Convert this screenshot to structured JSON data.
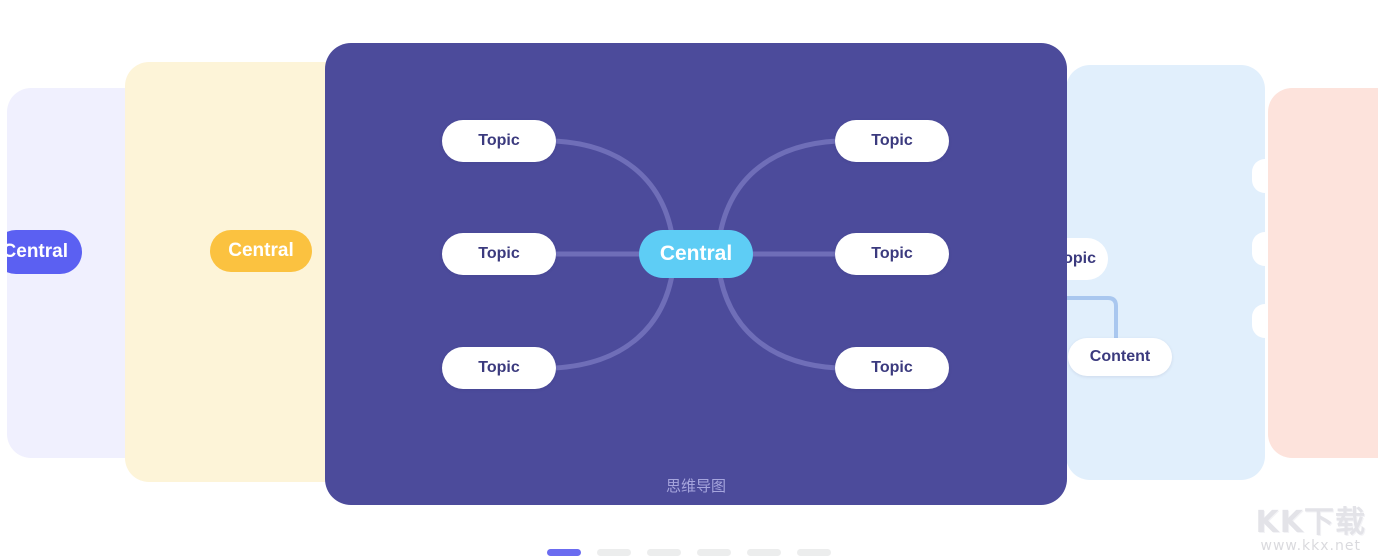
{
  "meta": {
    "scene": "mind-map-template-carousel",
    "background_color": "#ffffff"
  },
  "carousel": {
    "cards": [
      {
        "id": "lavender",
        "background": "#f0f0fe",
        "node_label": "Central",
        "node_color": "#5b60f2"
      },
      {
        "id": "yellow",
        "background": "#fdf4d8",
        "node_label": "Central",
        "node_color": "#fbc240"
      },
      {
        "id": "main",
        "background": "#4c4b9b",
        "active": true
      },
      {
        "id": "blue",
        "background": "#e1effc",
        "node_label": "Topic",
        "secondary_label": "Content",
        "connector_color": "#a9c7ef"
      },
      {
        "id": "pink",
        "background": "#fde3dc"
      }
    ]
  },
  "mindmap": {
    "caption": "思维导图",
    "caption_color": "#a6a5dd",
    "center": {
      "label": "Central",
      "background": "#5ecdf5",
      "text_color": "#ffffff"
    },
    "branch_color": "#6f6eb8",
    "nodes": {
      "left": [
        {
          "label": "Topic"
        },
        {
          "label": "Topic"
        },
        {
          "label": "Topic"
        }
      ],
      "right": [
        {
          "label": "Topic"
        },
        {
          "label": "Topic"
        },
        {
          "label": "Topic"
        }
      ]
    },
    "node_style": {
      "background": "#ffffff",
      "text_color": "#3b3a7e"
    }
  },
  "blue_card": {
    "topic_label": "Topic",
    "content_label": "Content"
  },
  "pagination": {
    "count": 6,
    "active_index": 0,
    "active_color": "#6b6cf0",
    "inactive_color": "#eceded",
    "items": [
      {
        "index": 1
      },
      {
        "index": 2
      },
      {
        "index": 3
      },
      {
        "index": 4
      },
      {
        "index": 5
      },
      {
        "index": 6
      }
    ]
  },
  "watermark": {
    "logo": "KK下载",
    "url": "www.kkx.net"
  }
}
